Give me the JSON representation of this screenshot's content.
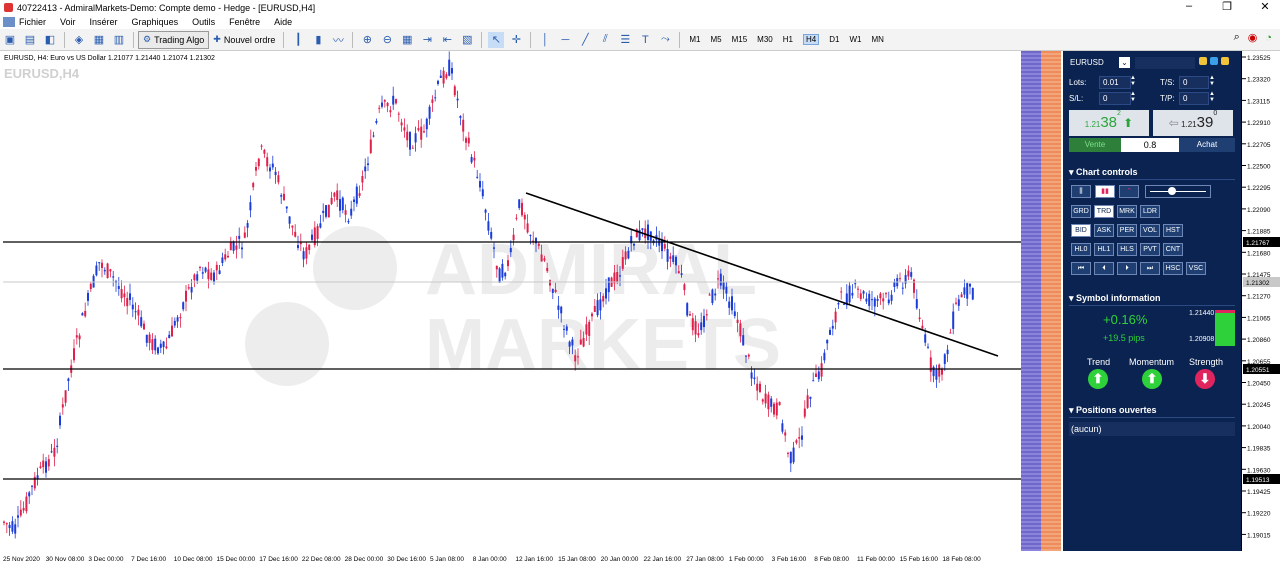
{
  "window": {
    "title": "40722413 - AdmiralMarkets-Demo: Compte demo - Hedge - [EURUSD,H4]"
  },
  "menu": [
    "Fichier",
    "Voir",
    "Insérer",
    "Graphiques",
    "Outils",
    "Fenêtre",
    "Aide"
  ],
  "toolbar": {
    "trading_algo": "Trading Algo",
    "new_order": "Nouvel ordre",
    "timeframes": [
      "M1",
      "M5",
      "M15",
      "M30",
      "H1",
      "H4",
      "D1",
      "W1",
      "MN"
    ],
    "active_timeframe": "H4"
  },
  "chart": {
    "header": "EURUSD, H4:  Euro vs US Dollar  1.21077 1.21440 1.21074 1.21302",
    "symbol_label": "EURUSD,H4",
    "watermark_line1": "ADMIRAL",
    "watermark_line2": "MARKETS",
    "y_labels": [
      "1.23525",
      "1.23320",
      "1.23115",
      "1.22910",
      "1.22705",
      "1.22500",
      "1.22295",
      "1.22090",
      "1.21885",
      "1.21680",
      "1.21475",
      "1.21270",
      "1.21065",
      "1.20860",
      "1.20655",
      "1.20450",
      "1.20245",
      "1.20040",
      "1.19835",
      "1.19630",
      "1.19425",
      "1.19220",
      "1.19015"
    ],
    "y_highlight_labels": [
      "1.21767",
      "1.21302",
      "1.20551",
      "1.19513"
    ],
    "x_labels": [
      "25 Nov 2020",
      "30 Nov 08:00",
      "3 Dec 00:00",
      "7 Dec 16:00",
      "10 Dec 08:00",
      "15 Dec 00:00",
      "17 Dec 16:00",
      "22 Dec 08:00",
      "28 Dec 00:00",
      "30 Dec 16:00",
      "5 Jan 08:00",
      "8 Jan 00:00",
      "12 Jan 16:00",
      "15 Jan 08:00",
      "20 Jan 00:00",
      "22 Jan 16:00",
      "27 Jan 08:00",
      "1 Feb 00:00",
      "3 Feb 16:00",
      "8 Feb 08:00",
      "11 Feb 00:00",
      "15 Feb 16:00",
      "18 Feb 08:00"
    ],
    "colors": {
      "bull": "#1a3cd8",
      "bear": "#e0204a",
      "line": "#000000"
    }
  },
  "panel": {
    "symbol": "EURUSD",
    "lots_label": "Lots:",
    "lots_value": "0.01",
    "ts_label": "T/S:",
    "ts_value": "0",
    "sl_label": "S/L:",
    "sl_value": "0",
    "tp_label": "T/P:",
    "tp_value": "0",
    "sell_prefix": "1.21",
    "sell_big": "38",
    "sell_sup": "2",
    "buy_prefix": "1.21",
    "buy_big": "39",
    "buy_sup": "0",
    "sell_label": "Vente",
    "spread": "0.8",
    "buy_label": "Achat",
    "chart_controls_title": "Chart controls",
    "ctrl_row1": [
      "GRD",
      "TRD",
      "MRK",
      "LDR"
    ],
    "ctrl_row2": [
      "BID",
      "ASK",
      "PER",
      "VOL",
      "HST"
    ],
    "ctrl_row3": [
      "HL0",
      "HL1",
      "HLS",
      "PVT",
      "CNT"
    ],
    "ctrl_row4": [
      "⏮",
      "⏴",
      "⏵",
      "⏭",
      "HSC",
      "VSC"
    ],
    "symbol_info_title": "Symbol information",
    "change_pct": "+0.16%",
    "change_pips": "+19.5 pips",
    "hi": "1.21440",
    "lo": "1.20908",
    "trend_label": "Trend",
    "momentum_label": "Momentum",
    "strength_label": "Strength",
    "positions_title": "Positions ouvertes",
    "positions_value": "(aucun)",
    "accent_green": "#2fd13a",
    "accent_red": "#e0245e"
  }
}
